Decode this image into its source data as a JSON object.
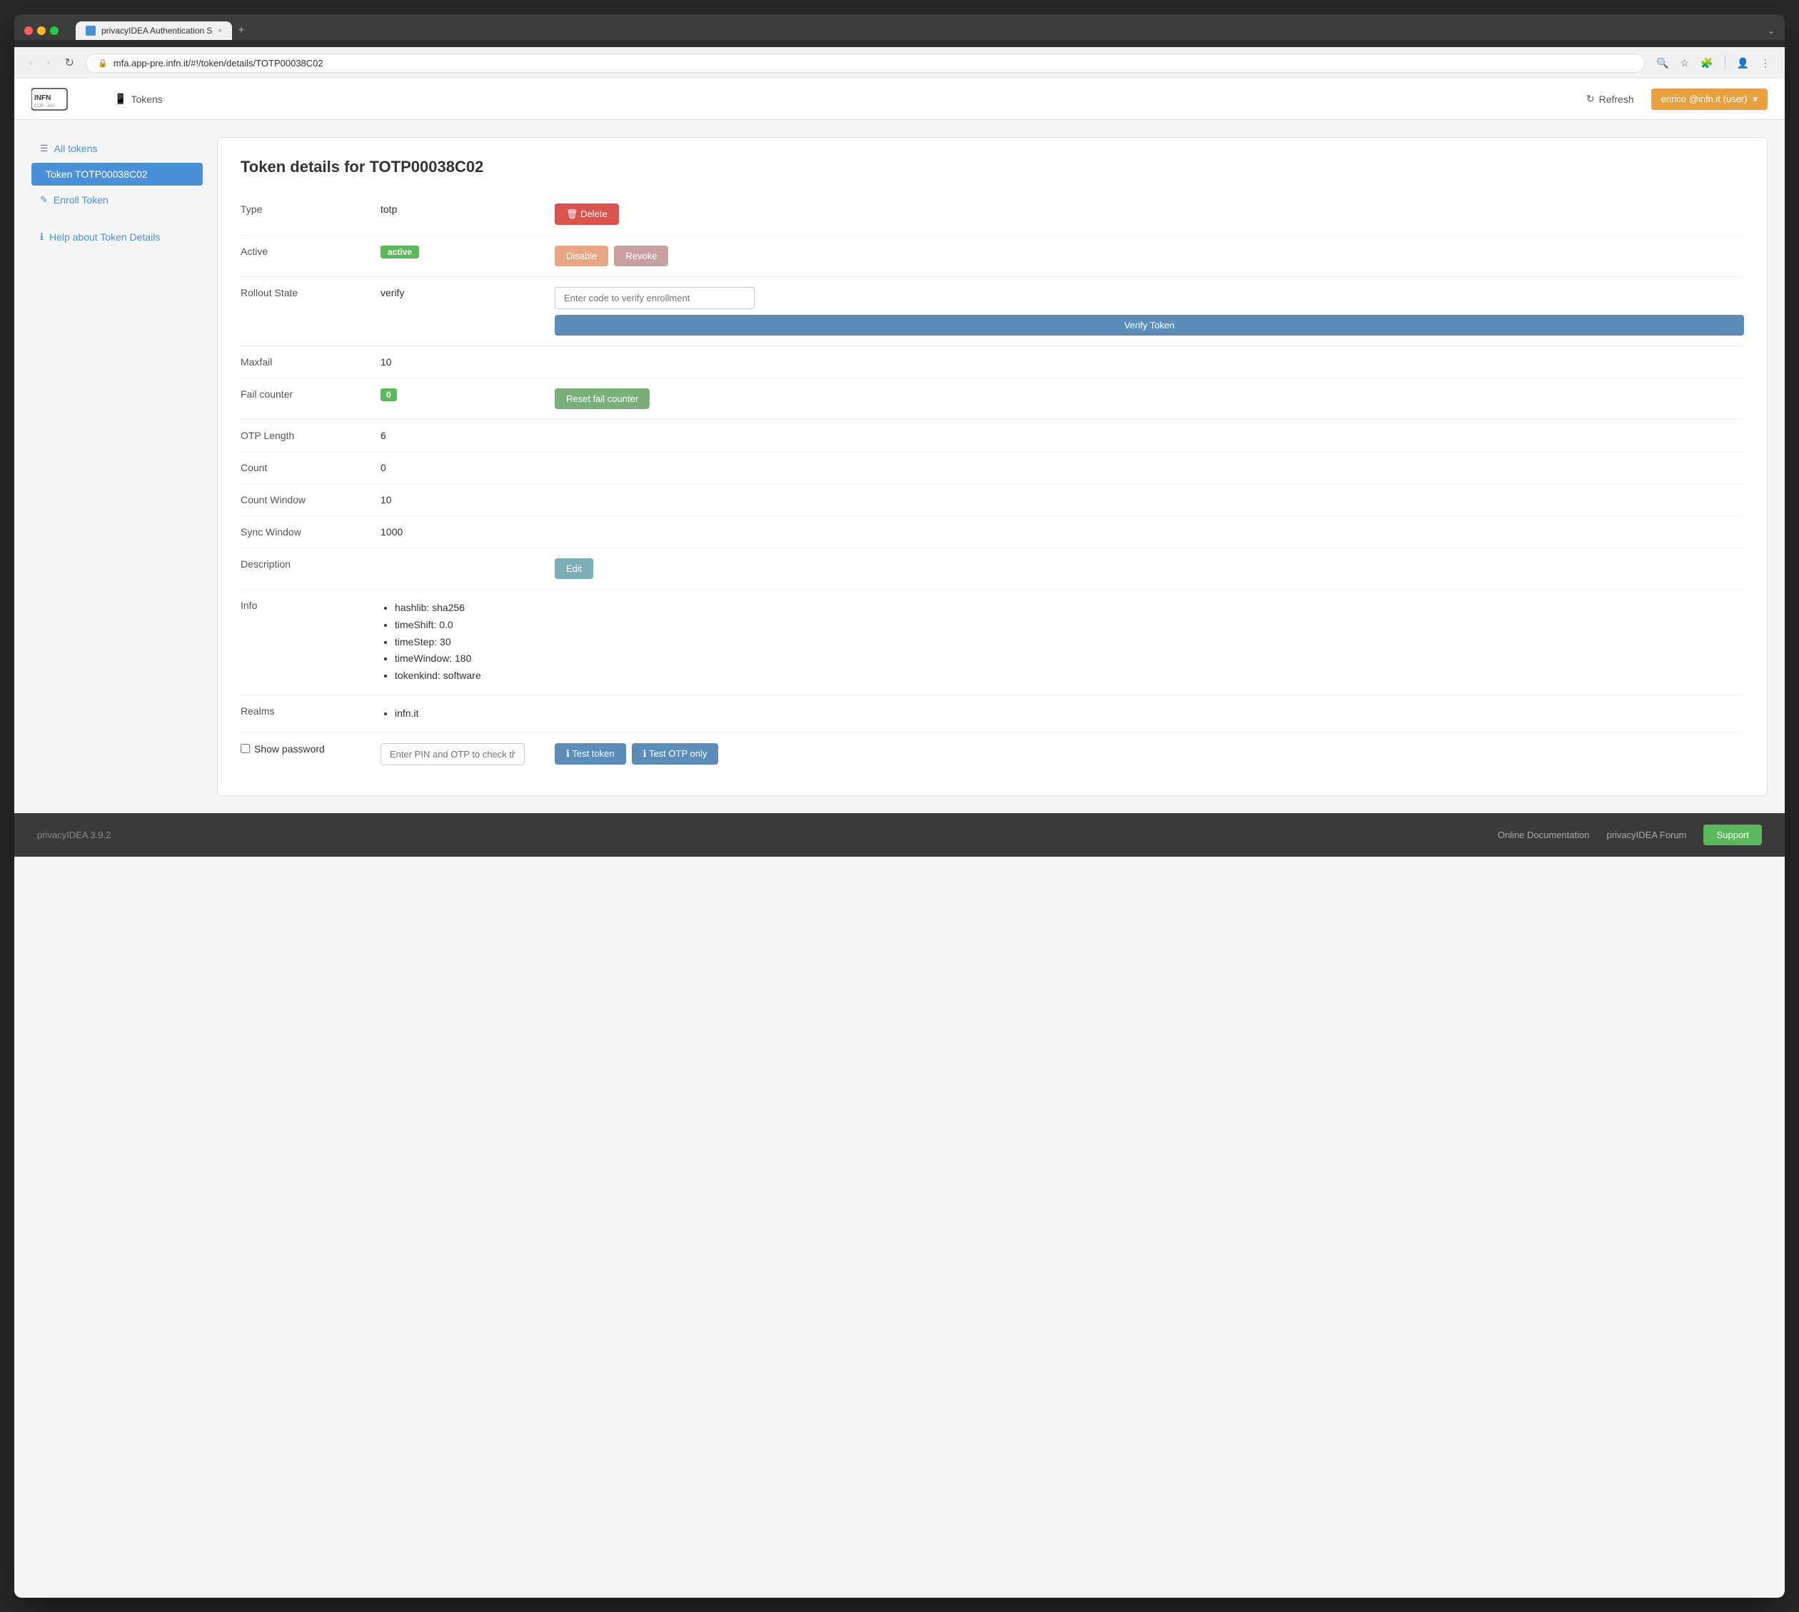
{
  "browser": {
    "url": "mfa.app-pre.infn.it/#!/token/details/TOTP00038C02",
    "tab_title": "privacyIDEA Authentication S",
    "tab_close": "×",
    "tab_new": "+",
    "nav_back": "‹",
    "nav_forward": "›",
    "nav_refresh": "↻"
  },
  "topnav": {
    "tokens_label": "Tokens",
    "refresh_label": "Refresh",
    "user_label": "enrico @infn.it (user)",
    "user_arrow": "▾"
  },
  "sidebar": {
    "all_tokens_label": "All tokens",
    "current_token_label": "Token TOTP00038C02",
    "enroll_label": "Enroll Token",
    "help_label": "Help about Token Details"
  },
  "token_details": {
    "title": "Token details for TOTP00038C02",
    "rows": [
      {
        "label": "Type",
        "value": "totp"
      },
      {
        "label": "Active",
        "value": "active"
      },
      {
        "label": "Rollout State",
        "value": "verify"
      },
      {
        "label": "Maxfail",
        "value": "10"
      },
      {
        "label": "Fail counter",
        "value": "0"
      },
      {
        "label": "OTP Length",
        "value": "6"
      },
      {
        "label": "Count",
        "value": "0"
      },
      {
        "label": "Count Window",
        "value": "10"
      },
      {
        "label": "Sync Window",
        "value": "1000"
      },
      {
        "label": "Description",
        "value": ""
      },
      {
        "label": "Info",
        "value": ""
      },
      {
        "label": "Realms",
        "value": ""
      }
    ],
    "info_items": [
      "hashlib: sha256",
      "timeShift: 0.0",
      "timeStep: 30",
      "timeWindow: 180",
      "tokenkind: software"
    ],
    "realms_items": [
      "infn.it"
    ],
    "buttons": {
      "delete": "Delete",
      "disable": "Disable",
      "revoke": "Revoke",
      "verify_placeholder": "Enter code to verify enrollment",
      "verify_token": "Verify Token",
      "reset_fail_counter": "Reset fail counter",
      "edit": "Edit",
      "test_token": "Test token",
      "test_otp_only": "Test OTP only"
    },
    "show_password_label": "Show password",
    "pin_placeholder": "Enter PIN and OTP to check the toke"
  },
  "footer": {
    "version": "privacyIDEA 3.9.2",
    "doc_link": "Online Documentation",
    "forum_link": "privacyIDEA Forum",
    "support_label": "Support"
  },
  "icons": {
    "list": "☰",
    "phone": "📱",
    "enroll": "✎",
    "refresh": "↻",
    "info": "ℹ",
    "trash": "🗑",
    "question": "?",
    "shield": "🔒"
  }
}
